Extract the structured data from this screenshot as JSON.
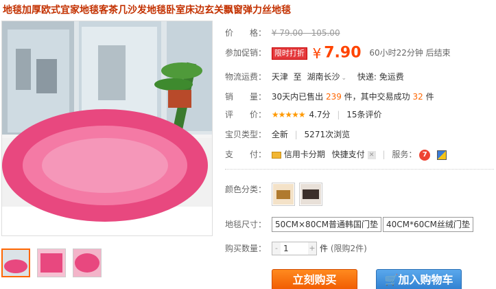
{
  "product": {
    "title": "地毯加厚欧式宜家地毯客茶几沙发地毯卧室床边玄关飘窗弹力丝地毯"
  },
  "price": {
    "label": "价　　格：",
    "original": "¥ 79.00 - 105.00"
  },
  "promo": {
    "label": "参加促销：",
    "tag": "限时打折",
    "currency": "¥",
    "price": "7.90",
    "countdown": "60小时22分钟 后结束"
  },
  "shipping": {
    "label": "物流运费：",
    "from": "天津",
    "to_prefix": "至",
    "to": "湖南长沙",
    "express": "快递: 免运费"
  },
  "sales": {
    "label": "销　　量：",
    "prefix": "30天内已售出",
    "sold": "239",
    "middle": "件，其中交易成功",
    "success": "32",
    "suffix": "件"
  },
  "rating": {
    "label": "评　　价：",
    "stars": "★★★★★",
    "score": "4.7分",
    "reviews": "15条评价"
  },
  "type": {
    "label": "宝贝类型：",
    "condition": "全新",
    "views": "5271次浏览"
  },
  "payment": {
    "label": "支　　付：",
    "credit": "信用卡分期",
    "quick": "快捷支付",
    "service_label": "服务："
  },
  "color": {
    "label": "颜色分类："
  },
  "size": {
    "label": "地毯尺寸：",
    "options": [
      "50CM×80CM普通韩国门垫",
      "40CM*60CM丝绒门垫"
    ]
  },
  "quantity": {
    "label": "购买数量：",
    "minus": "-",
    "value": "1",
    "plus": "+",
    "unit": "件",
    "limit": "(限购2件)"
  },
  "actions": {
    "buy": "立刻购买",
    "cart": "加入购物车"
  },
  "colors": {
    "accent": "#ff4400",
    "title": "#c33100",
    "buy_button": "#f05a00",
    "cart_button": "#2f7fd0",
    "rug_pink": "#e8487f"
  }
}
